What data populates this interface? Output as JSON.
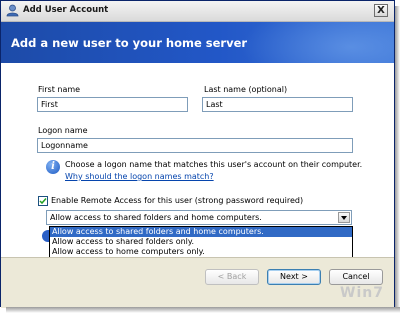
{
  "window": {
    "title": "Add User Account",
    "close_label": "X"
  },
  "banner": {
    "title": "Add a new user to your home server"
  },
  "form": {
    "first_name_label": "First name",
    "first_name_value": "First",
    "last_name_label": "Last name (optional)",
    "last_name_value": "Last",
    "logon_label": "Logon name",
    "logon_value": "Logonname",
    "hint_text": "Choose a logon name that matches this user's account on their computer.",
    "hint_link": "Why should the logon names match?",
    "remote_access_label": "Enable Remote Access for this user (strong password required)",
    "remote_access_checked": true,
    "access_selected": "Allow access to shared folders and home computers.",
    "access_options": [
      "Allow access to shared folders and home computers.",
      "Allow access to shared folders only.",
      "Allow access to home computers only."
    ]
  },
  "buttons": {
    "back": "< Back",
    "next": "Next >",
    "cancel": "Cancel"
  },
  "watermark": "Win7"
}
